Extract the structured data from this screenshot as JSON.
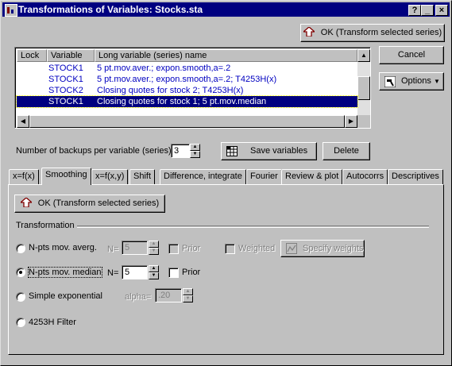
{
  "window": {
    "title": "Transformations of Variables: Stocks.sta"
  },
  "caption_buttons": [
    "?",
    "_",
    "×"
  ],
  "buttons": {
    "ok_top": "OK (Transform selected series)",
    "cancel": "Cancel",
    "options": "Options",
    "save_variables": "Save variables",
    "delete": "Delete",
    "ok_panel": "OK (Transform selected series)",
    "specify_weights": "Specify weights"
  },
  "list": {
    "columns": [
      "Lock",
      "Variable",
      "Long variable (series) name"
    ],
    "rows": [
      {
        "lock": "",
        "variable": "STOCK1",
        "name": "5 pt.mov.aver.; expon.smooth,a=.2",
        "selected": false
      },
      {
        "lock": "",
        "variable": "STOCK1",
        "name": "5 pt.mov.aver.; expon.smooth,a=.2; T4253H(x)",
        "selected": false
      },
      {
        "lock": "",
        "variable": "STOCK2",
        "name": "Closing quotes for stock 2; T4253H(x)",
        "selected": false
      },
      {
        "lock": "",
        "variable": "STOCK1",
        "name": "Closing quotes for stock 1; 5 pt.mov.median",
        "selected": true
      }
    ]
  },
  "backups": {
    "label": "Number of backups per variable (series):",
    "value": "3"
  },
  "tabs": [
    "x=f(x)",
    "Smoothing",
    "x=f(x,y)",
    "Shift",
    "Difference, integrate",
    "Fourier",
    "Review & plot",
    "Autocorrs",
    "Descriptives"
  ],
  "active_tab": "Smoothing",
  "panel": {
    "group_label": "Transformation",
    "options": [
      {
        "label": "N-pts mov. averg.",
        "selected": false
      },
      {
        "label": "N-pts mov. median",
        "selected": true
      },
      {
        "label": "Simple exponential",
        "selected": false
      },
      {
        "label": "4253H Filter",
        "selected": false
      }
    ],
    "n_label": "N=",
    "n_avg_value": "5",
    "n_median_value": "5",
    "prior_label": "Prior",
    "weighted_label": "Weighted",
    "alpha_label": "alpha=",
    "alpha_value": ".20"
  },
  "colors": {
    "titlebar": "#000080",
    "selection": "#000080",
    "list_text": "#0000c0"
  }
}
